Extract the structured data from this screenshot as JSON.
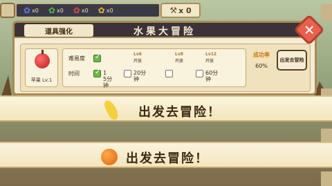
{
  "resources": [
    {
      "icon": "blue-flower-icon",
      "glyph": "✿",
      "color": "#5b7be0",
      "count": "x0"
    },
    {
      "icon": "green-flower-icon",
      "glyph": "✿",
      "color": "#57b84a",
      "count": "x0"
    },
    {
      "icon": "red-flower-icon",
      "glyph": "✿",
      "color": "#e04b4b",
      "count": "x0"
    },
    {
      "icon": "yellow-flower-icon",
      "glyph": "✿",
      "color": "#e6b833",
      "count": "x0"
    }
  ],
  "tools": {
    "icon": "crossed-tools-icon",
    "count": "x 0"
  },
  "window": {
    "tab_label": "道具强化",
    "title": "水果大冒险"
  },
  "fruit": {
    "name": "苹果 Lv.1"
  },
  "settings": {
    "difficulty_label": "难易度",
    "time_label": "时间",
    "options": [
      {
        "level": "",
        "difficulty": "",
        "time": "1\n5分\n钟",
        "checked_top": true,
        "checked_bottom": true
      },
      {
        "level": "Lv6",
        "difficulty": "开放",
        "time": "20分\n钟",
        "checked_top": false,
        "checked_bottom": false
      },
      {
        "level": "Lv8",
        "difficulty": "开放",
        "time": "",
        "checked_top": false,
        "checked_bottom": false
      },
      {
        "level": "Lv12",
        "difficulty": "开放",
        "time": "60分\n钟",
        "checked_top": false,
        "checked_bottom": false
      }
    ]
  },
  "success": {
    "label": "成功率",
    "value": "60%"
  },
  "go_button": "出发去冒险",
  "banners": [
    {
      "fruit": "banana-icon",
      "text": "出发去冒险！"
    },
    {
      "fruit": "orange-icon",
      "text": "出发去冒险！"
    }
  ]
}
